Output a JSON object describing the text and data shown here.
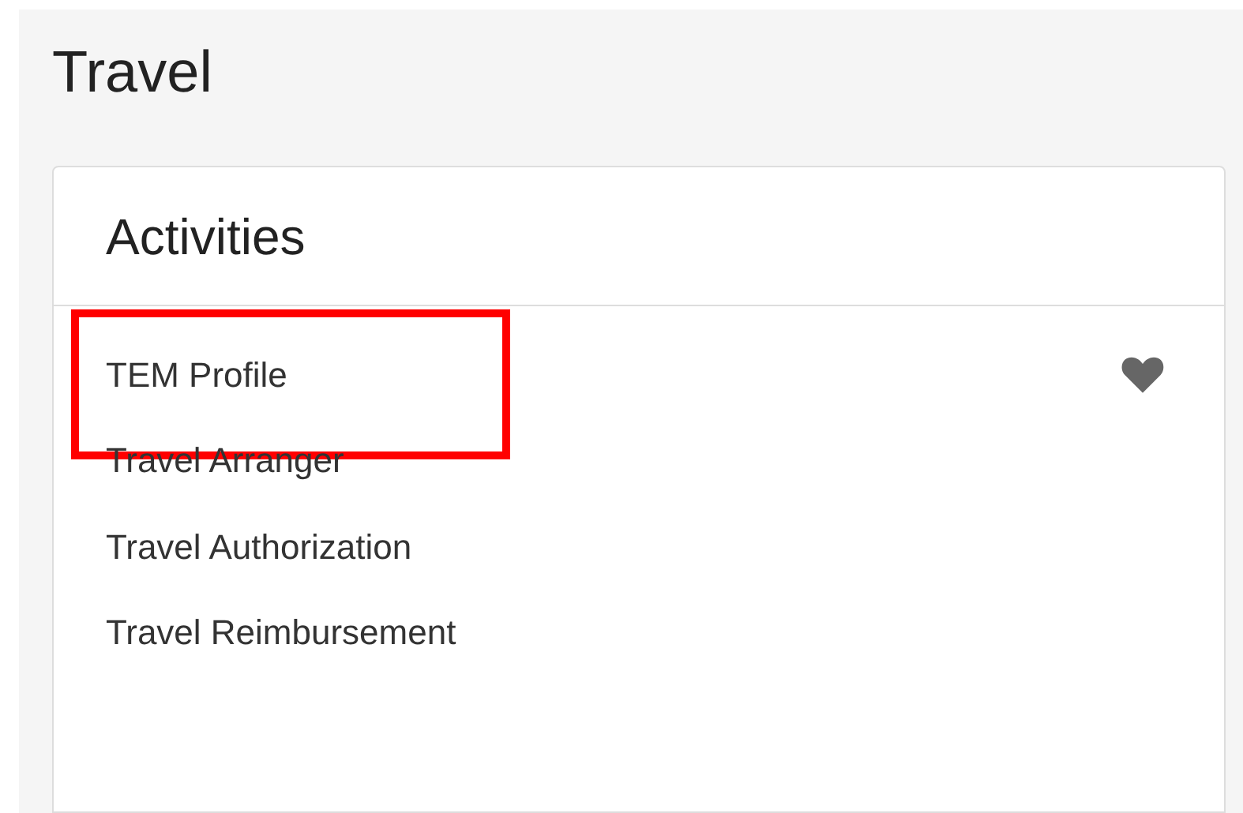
{
  "page": {
    "title": "Travel"
  },
  "card": {
    "title": "Activities",
    "items": [
      {
        "label": "TEM Profile",
        "favorite": true,
        "highlighted": true
      },
      {
        "label": "Travel Arranger",
        "favorite": false,
        "highlighted": false
      },
      {
        "label": "Travel Authorization",
        "favorite": false,
        "highlighted": false
      },
      {
        "label": "Travel Reimbursement",
        "favorite": false,
        "highlighted": false
      }
    ]
  }
}
